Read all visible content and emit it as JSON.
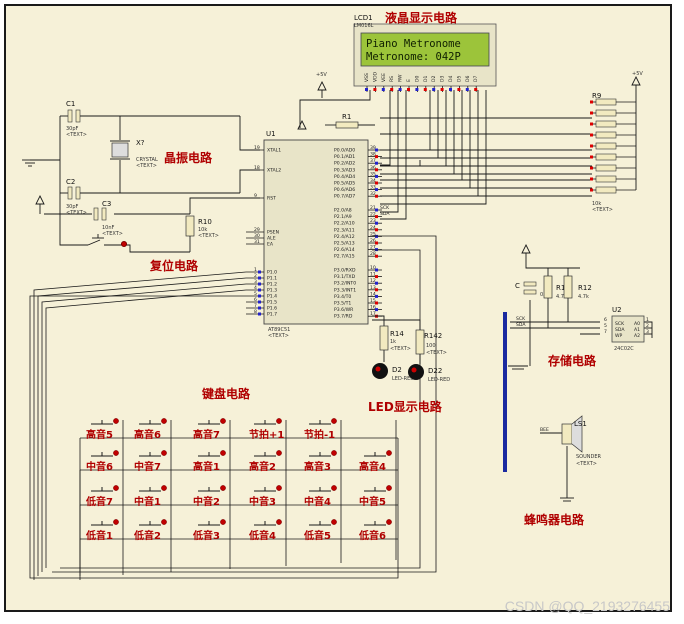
{
  "lcd": {
    "ref": "LCD1",
    "model": "LM016L",
    "line1": "Piano Metronome",
    "line2": "Metronome: 042P",
    "pins": [
      "VSS",
      "VDD",
      "VEE",
      "RS",
      "RW",
      "E",
      "D0",
      "D1",
      "D2",
      "D3",
      "D4",
      "D5",
      "D6",
      "D7"
    ]
  },
  "mcu": {
    "ref": "U1",
    "part": "AT89C51",
    "text": "<TEXT>",
    "left_pins": [
      {
        "n": "19",
        "name": "XTAL1"
      },
      {
        "n": "18",
        "name": "XTAL2"
      },
      {
        "n": "9",
        "name": "RST"
      },
      {
        "n": "29",
        "name": "PSEN"
      },
      {
        "n": "30",
        "name": "ALE"
      },
      {
        "n": "31",
        "name": "EA"
      },
      {
        "n": "1",
        "name": "P1.0"
      },
      {
        "n": "2",
        "name": "P1.1"
      },
      {
        "n": "3",
        "name": "P1.2"
      },
      {
        "n": "4",
        "name": "P1.3"
      },
      {
        "n": "5",
        "name": "P1.4"
      },
      {
        "n": "6",
        "name": "P1.5"
      },
      {
        "n": "7",
        "name": "P1.6"
      },
      {
        "n": "8",
        "name": "P1.7"
      }
    ],
    "right_pins": [
      {
        "n": "39",
        "name": "P0.0/AD0"
      },
      {
        "n": "38",
        "name": "P0.1/AD1"
      },
      {
        "n": "37",
        "name": "P0.2/AD2"
      },
      {
        "n": "36",
        "name": "P0.3/AD3"
      },
      {
        "n": "35",
        "name": "P0.4/AD4"
      },
      {
        "n": "34",
        "name": "P0.5/AD5"
      },
      {
        "n": "33",
        "name": "P0.6/AD6"
      },
      {
        "n": "32",
        "name": "P0.7/AD7"
      },
      {
        "n": "21",
        "name": "P2.0/A8"
      },
      {
        "n": "22",
        "name": "P2.1/A9"
      },
      {
        "n": "23",
        "name": "P2.2/A10"
      },
      {
        "n": "24",
        "name": "P2.3/A11"
      },
      {
        "n": "25",
        "name": "P2.4/A12"
      },
      {
        "n": "26",
        "name": "P2.5/A13"
      },
      {
        "n": "27",
        "name": "P2.6/A14"
      },
      {
        "n": "28",
        "name": "P2.7/A15"
      },
      {
        "n": "10",
        "name": "P3.0/RXD"
      },
      {
        "n": "11",
        "name": "P3.1/TXD"
      },
      {
        "n": "12",
        "name": "P3.2/INT0"
      },
      {
        "n": "13",
        "name": "P3.3/INT1"
      },
      {
        "n": "14",
        "name": "P3.4/T0"
      },
      {
        "n": "15",
        "name": "P3.5/T1"
      },
      {
        "n": "16",
        "name": "P3.6/WR"
      },
      {
        "n": "17",
        "name": "P3.7/RD"
      }
    ]
  },
  "sections": {
    "lcd": "液晶显示电路",
    "crystal": "晶振电路",
    "reset": "复位电路",
    "keyboard": "键盘电路",
    "led": "LED显示电路",
    "storage": "存储电路",
    "buzzer": "蜂鸣器电路"
  },
  "components": {
    "c1": {
      "ref": "C1",
      "value": "30pF",
      "text": "<TEXT>"
    },
    "c2": {
      "ref": "C2",
      "value": "30pF",
      "text": "<TEXT>"
    },
    "c3": {
      "ref": "C3",
      "value": "10nF",
      "text": "<TEXT>"
    },
    "x1": {
      "ref": "X?",
      "value": "CRYSTAL",
      "text": "<TEXT>"
    },
    "r1": {
      "ref": "R1",
      "text": "<TEXT>"
    },
    "r9": {
      "ref": "R9",
      "value": "10k",
      "text": "<TEXT>"
    },
    "r10": {
      "ref": "R10",
      "value": "10k",
      "text": "<TEXT>"
    },
    "r14": {
      "ref": "R14",
      "value": "1k",
      "text": "<TEXT>"
    },
    "r142": {
      "ref": "R142",
      "value": "100",
      "text": "<TEXT>"
    },
    "d2": {
      "ref": "D2",
      "value": "LED-RED"
    },
    "d22": {
      "ref": "D22",
      "value": "LED-RED"
    },
    "c_store": {
      "ref": "C",
      "value": "0.1"
    },
    "r1_store": {
      "ref": "R1",
      "value": "4.7k"
    },
    "r12": {
      "ref": "R12",
      "value": "4.7k"
    },
    "u2": {
      "ref": "U2",
      "part": "24C02C",
      "pins_left": [
        "SCK",
        "SDA",
        "WP"
      ],
      "pins_right": [
        "A0",
        "A1",
        "A2"
      ],
      "nums_left": [
        "6",
        "5",
        "7"
      ],
      "nums_right": [
        "1",
        "2",
        "3"
      ]
    },
    "ls1": {
      "ref": "LS1",
      "value": "SOUNDER",
      "text": "<TEXT>",
      "net": "BEE"
    },
    "net_sck": "SCK",
    "net_sda": "SDA",
    "vcc": "+5V"
  },
  "keys": [
    [
      "高音5",
      "高音6",
      "高音7",
      "节拍+1",
      "节拍-1"
    ],
    [
      "中音6",
      "中音7",
      "高音1",
      "高音2",
      "高音3",
      "高音4"
    ],
    [
      "低音7",
      "中音1",
      "中音2",
      "中音3",
      "中音4",
      "中音5"
    ],
    [
      "低音1",
      "低音2",
      "低音3",
      "低音4",
      "低音5",
      "低音6"
    ]
  ],
  "watermark": "CSDN @QQ_2193276455"
}
